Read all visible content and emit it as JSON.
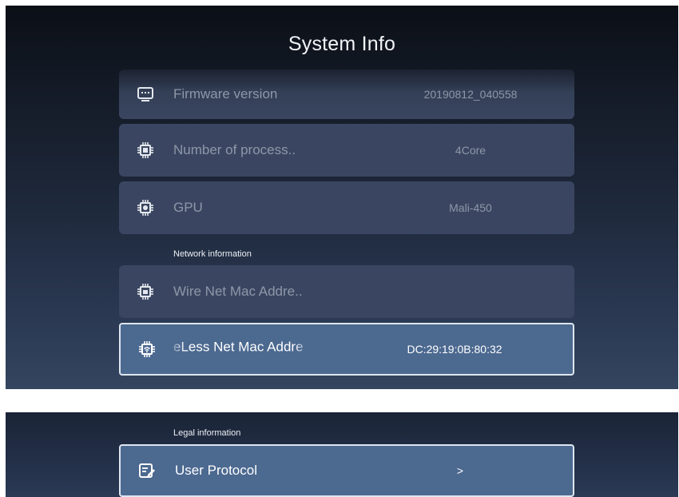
{
  "title": "System Info",
  "rows": [
    {
      "label": "Firmware version",
      "value": "20190812_040558",
      "icon": "monitor-icon"
    },
    {
      "label": "Number of process..",
      "value": "4Core",
      "icon": "chip-icon"
    },
    {
      "label": "GPU",
      "value": "Mali-450",
      "icon": "gear-chip-icon"
    }
  ],
  "network": {
    "section_label": "Network information",
    "wired": {
      "label": "Wire Net Mac Addre..",
      "value": "",
      "icon": "ethernet-chip-icon"
    },
    "wireless": {
      "label": "eLess Net Mac Addre",
      "value": "DC:29:19:0B:80:32",
      "icon": "wifi-chip-icon"
    }
  },
  "legal": {
    "section_label": "Legal information",
    "user_protocol": {
      "label": "User Protocol",
      "chevron": ">",
      "icon": "edit-document-icon"
    }
  },
  "colors": {
    "row_bg": "#3a4661",
    "focus_bg": "#4c6990",
    "focus_border": "#dfe6f0"
  }
}
